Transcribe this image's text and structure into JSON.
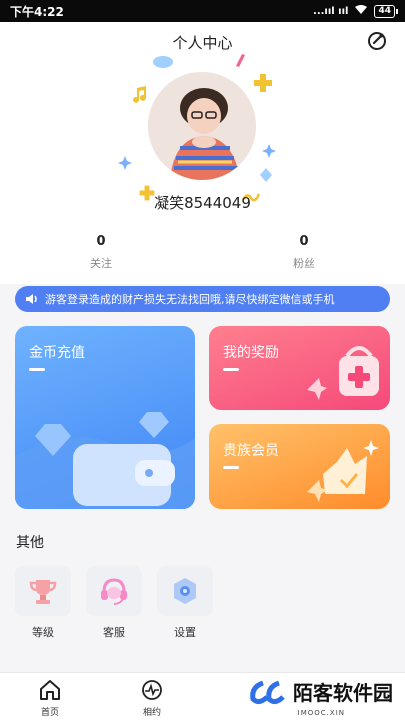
{
  "status_bar": {
    "time": "下午4:22",
    "signal": "...ııl ııl",
    "battery": "44"
  },
  "header": {
    "title": "个人中心"
  },
  "profile": {
    "username": "凝笑8544049"
  },
  "stats": [
    {
      "value": "0",
      "label": "关注"
    },
    {
      "value": "0",
      "label": "粉丝"
    }
  ],
  "notice": {
    "text": "游客登录造成的财产损失无法找回哦,请尽快绑定微信或手机"
  },
  "cards": {
    "coins": "金币充值",
    "rewards": "我的奖励",
    "vip": "贵族会员"
  },
  "other": {
    "title": "其他",
    "items": [
      {
        "label": "等级",
        "icon": "trophy-icon"
      },
      {
        "label": "客服",
        "icon": "headset-icon"
      },
      {
        "label": "设置",
        "icon": "settings-icon"
      }
    ]
  },
  "bottom_nav": [
    {
      "label": "首页",
      "icon": "home-icon"
    },
    {
      "label": "相约",
      "icon": "pulse-icon"
    }
  ],
  "watermark": {
    "brand": "陌客软件园",
    "sub": "IMOOC.XIN"
  },
  "colors": {
    "notice_bg": "#4f7ff2",
    "coins_card": "#4a8ff6",
    "rewards_card": "#f75e82",
    "vip_card": "#ffa33f"
  }
}
